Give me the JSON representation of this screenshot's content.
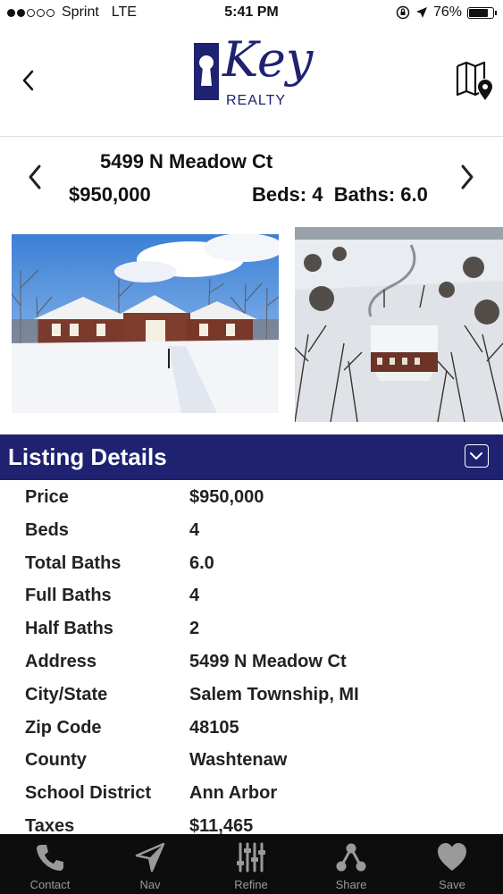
{
  "status_bar": {
    "carrier": "Sprint",
    "network": "LTE",
    "time": "5:41 PM",
    "battery": "76%",
    "battery_level": 0.76
  },
  "header": {
    "logo_text": "Key",
    "logo_subtext": "REALTY",
    "back_icon": "chevron-left-icon",
    "map_icon": "map-pin-icon"
  },
  "listing": {
    "address": "5499 N Meadow Ct",
    "price": "$950,000",
    "beds_baths": "Beds: 4  Baths: 6.0"
  },
  "details": {
    "title": "Listing Details",
    "rows": [
      {
        "label": "Price",
        "value": "$950,000"
      },
      {
        "label": "Beds",
        "value": "4"
      },
      {
        "label": "Total Baths",
        "value": "6.0"
      },
      {
        "label": "Full Baths",
        "value": "4"
      },
      {
        "label": "Half Baths",
        "value": "2"
      },
      {
        "label": "Address",
        "value": "5499 N Meadow Ct"
      },
      {
        "label": "City/State",
        "value": "Salem Township, MI"
      },
      {
        "label": "Zip Code",
        "value": "48105"
      },
      {
        "label": "County",
        "value": "Washtenaw"
      },
      {
        "label": "School District",
        "value": "Ann Arbor"
      },
      {
        "label": "Taxes",
        "value": "$11,465"
      }
    ]
  },
  "tabs": [
    {
      "label": "Contact",
      "icon": "phone-icon"
    },
    {
      "label": "Nav",
      "icon": "navigation-arrow-icon"
    },
    {
      "label": "Refine",
      "icon": "sliders-icon"
    },
    {
      "label": "Share",
      "icon": "share-icon"
    },
    {
      "label": "Save",
      "icon": "heart-icon"
    }
  ],
  "colors": {
    "brand_navy": "#1f2270",
    "tabbar_bg": "#0d0d0d",
    "tab_icon": "#9a9a9a"
  }
}
